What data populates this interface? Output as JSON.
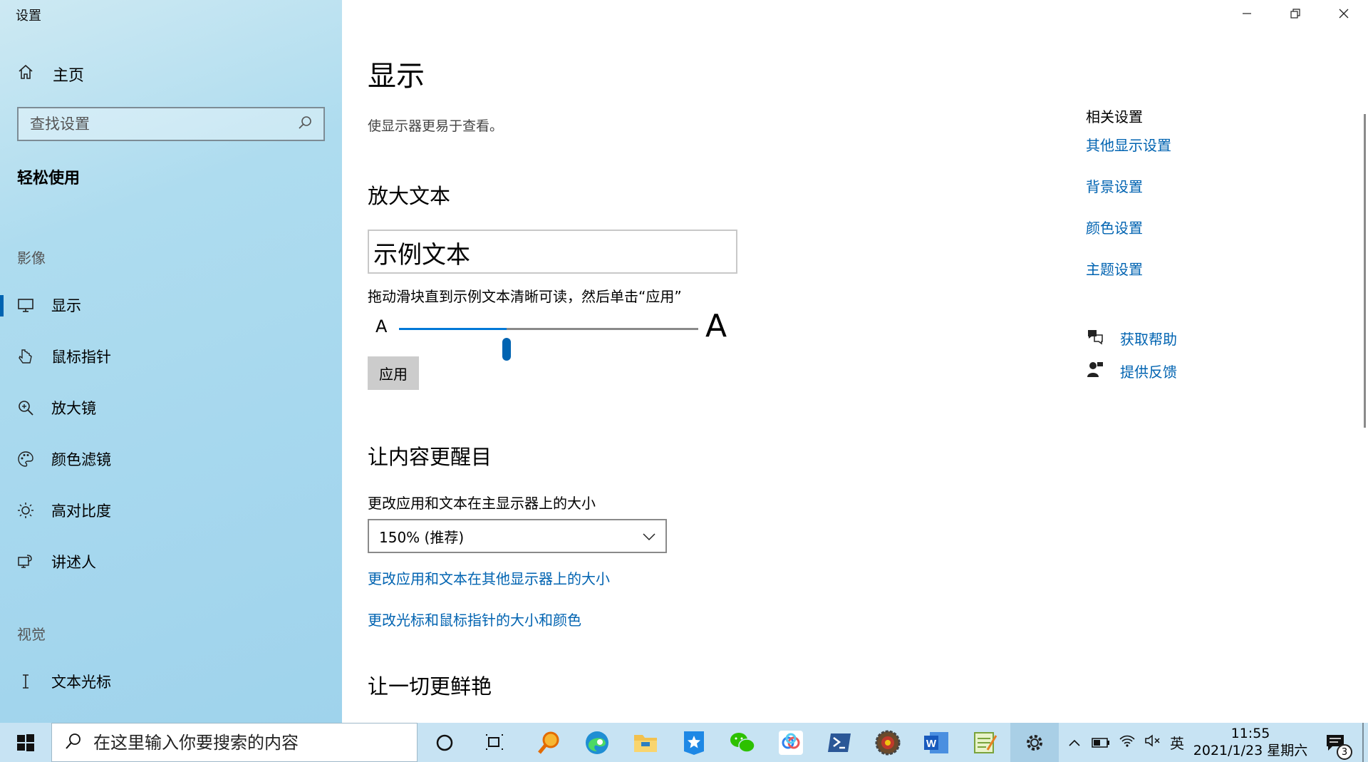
{
  "window": {
    "app_title": "设置",
    "minimize": "—",
    "restore": "❐",
    "close": "✕"
  },
  "sidebar": {
    "home_label": "主页",
    "search_placeholder": "查找设置",
    "section_title": "轻松使用",
    "groups": [
      {
        "label": "影像"
      },
      {
        "label": "视觉"
      }
    ],
    "items": [
      {
        "label": "显示",
        "icon": "monitor-icon",
        "active": true
      },
      {
        "label": "鼠标指针",
        "icon": "pointer-icon",
        "active": false
      },
      {
        "label": "放大镜",
        "icon": "magnifier-icon",
        "active": false
      },
      {
        "label": "颜色滤镜",
        "icon": "palette-icon",
        "active": false
      },
      {
        "label": "高对比度",
        "icon": "sun-icon",
        "active": false
      },
      {
        "label": "讲述人",
        "icon": "narrator-icon",
        "active": false
      },
      {
        "label": "文本光标",
        "icon": "text-cursor-icon",
        "active": false
      }
    ]
  },
  "main": {
    "title": "显示",
    "description": "使显示器更易于查看。",
    "enlarge_text": {
      "heading": "放大文本",
      "sample_text": "示例文本",
      "hint": "拖动滑块直到示例文本清晰可读，然后单击“应用”",
      "small_a": "A",
      "large_a": "A",
      "slider_value": 0.36,
      "apply_label": "应用"
    },
    "make_bigger": {
      "heading": "让内容更醒目",
      "field_label": "更改应用和文本在主显示器上的大小",
      "dropdown_value": "150% (推荐)",
      "link1": "更改应用和文本在其他显示器上的大小",
      "link2": "更改光标和鼠标指针的大小和颜色"
    },
    "brighter": {
      "heading": "让一切更鲜艳"
    }
  },
  "related": {
    "title": "相关设置",
    "links": [
      "其他显示设置",
      "背景设置",
      "颜色设置",
      "主题设置"
    ],
    "help": "获取帮助",
    "feedback": "提供反馈"
  },
  "taskbar": {
    "search_placeholder": "在这里输入你要搜索的内容",
    "apps": [
      "cortana-icon",
      "task-view-icon",
      "search-app-icon",
      "edge-icon",
      "file-explorer-icon",
      "app-icon",
      "wechat-icon",
      "baidu-netdisk-icon",
      "powershell-icon",
      "game-icon",
      "word-icon",
      "notepad-icon",
      "settings-icon"
    ],
    "tray": {
      "ime": "英",
      "time": "11:55",
      "date": "2021/1/23 星期六",
      "notification_count": "3"
    }
  },
  "colors": {
    "accent": "#0063b1",
    "sidebar_bg": "#a7d8ee",
    "taskbar_bg": "#c7e3f3"
  }
}
